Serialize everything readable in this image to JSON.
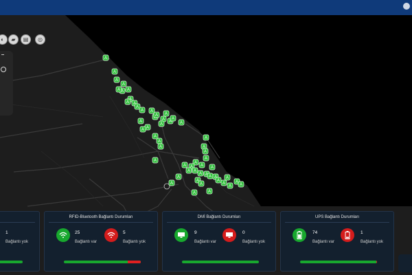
{
  "topbar": {
    "bg_color": "#0f3a7a",
    "user_icon": "user-icon"
  },
  "toolbar": {
    "buttons": [
      "globe-icon",
      "layers-icon",
      "document-icon",
      "settings-icon"
    ]
  },
  "side_panel": {
    "dash_label": "-"
  },
  "map": {
    "marker_label": "A",
    "marker_color": "#2fbf3a",
    "land_color": "#1d1d1d",
    "sea_color": "#000000"
  },
  "cards": [
    {
      "title": "",
      "left_value": "",
      "left_label": "",
      "right_value": "1",
      "right_label": "Bağlantı yok",
      "ok_fraction": 1.0
    },
    {
      "title": "RFID-Bluetooth Bağlantı Durumları",
      "left_icon": "wifi-icon",
      "left_value": "25",
      "left_label": "Bağlantı var",
      "right_icon": "wifi-icon",
      "right_value": "5",
      "right_label": "Bağlantı yok",
      "ok_fraction": 0.83
    },
    {
      "title": "DMİ Bağlantı Durumları",
      "left_icon": "monitor-icon",
      "left_value": "9",
      "left_label": "Bağlantı var",
      "right_icon": "monitor-icon",
      "right_value": "0",
      "right_label": "Bağlantı yok",
      "ok_fraction": 1.0
    },
    {
      "title": "UPS Bağlantı Durumları",
      "left_icon": "battery-icon",
      "left_value": "74",
      "left_label": "Bağlantı var",
      "right_icon": "battery-icon",
      "right_value": "1",
      "right_label": "Bağlantı yok",
      "ok_fraction": 0.99
    }
  ],
  "colors": {
    "ok": "#18a82e",
    "bad": "#d41c1c",
    "card_bg": "#13202e"
  }
}
